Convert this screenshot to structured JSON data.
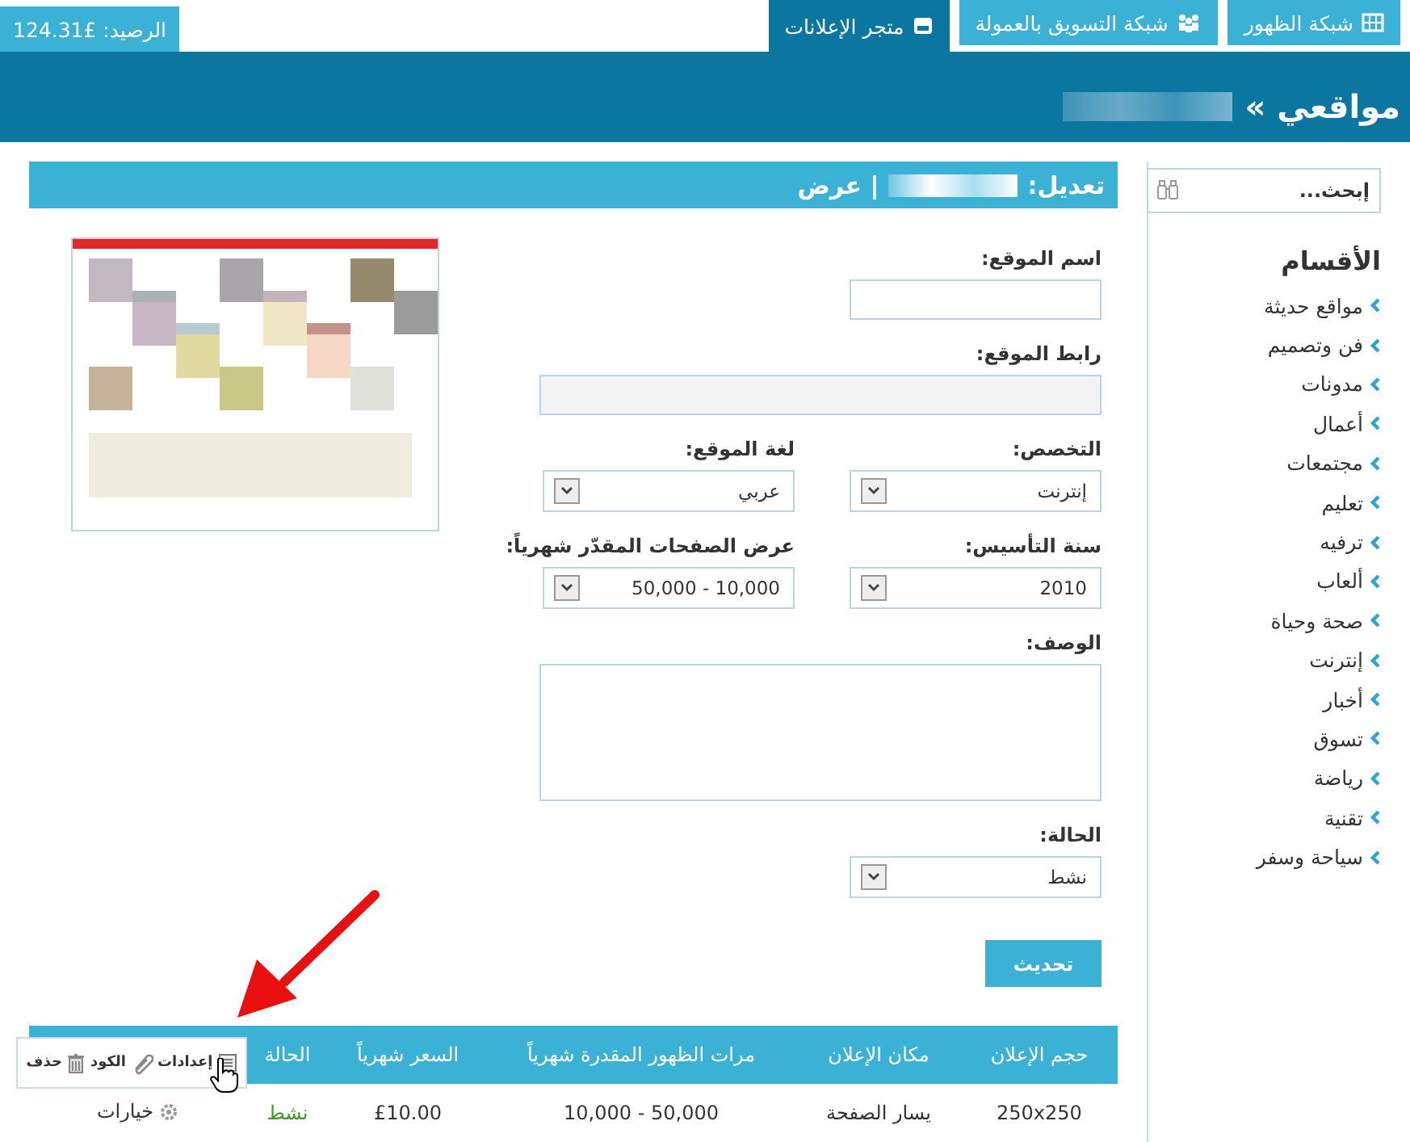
{
  "top_bar": {
    "balance": "الرصيد: £124.31",
    "tabs": [
      {
        "label": "شبكة الظهور",
        "selected": false
      },
      {
        "label": "شبكة التسويق بالعمولة",
        "selected": false
      },
      {
        "label": "متجر الإعلانات",
        "selected": true
      }
    ]
  },
  "header": {
    "title": "مواقعي »"
  },
  "sidebar": {
    "search": {
      "placeholder": "إبحث..."
    },
    "heading": "الأقسام",
    "items": [
      "مواقع حديثة",
      "فن وتصميم",
      "مدونات",
      "أعمال",
      "مجتمعات",
      "تعليم",
      "ترفيه",
      "ألعاب",
      "صحة وحياة",
      "إنترنت",
      "أخبار",
      "تسوق",
      "رياضة",
      "تقنية",
      "سياحة وسفر"
    ]
  },
  "editor": {
    "title_prefix": "تعديل:",
    "title_suffix": "| عرض",
    "fields": [
      {
        "kind": "input",
        "label": "اسم الموقع:",
        "disabled": false
      },
      {
        "kind": "wide_input",
        "label": "رابط الموقع:",
        "disabled": true
      },
      {
        "kind": "select",
        "label": "التخصص:",
        "value": "إنترنت"
      },
      {
        "kind": "select",
        "label": "لغة الموقع:",
        "value": "عربي"
      },
      {
        "kind": "select",
        "label": "سنة التأسيس:",
        "value": "2010"
      },
      {
        "kind": "select",
        "label": "عرض الصفحات المقدّر شهرياً:",
        "value": "50,000 - 10,000"
      },
      {
        "kind": "textarea",
        "label": "الوصف:"
      },
      {
        "kind": "select",
        "label": "الحالة:",
        "value": "نشط"
      }
    ],
    "submit": "تحديث"
  },
  "table": {
    "columns": [
      "حجم الإعلان",
      "مكان الإعلان",
      "مرات الظهور المقدرة شهرياً",
      "السعر شهرياً",
      "الحالة"
    ],
    "rows": [
      {
        "cells": [
          "250x250",
          "يسار الصفحة",
          "10,000 - 50,000",
          "£10.00",
          "نشط"
        ],
        "active": true,
        "options": "خيارات"
      }
    ],
    "menu": [
      {
        "label": "إعدادات"
      },
      {
        "label": "الكود"
      },
      {
        "label": "حذف"
      }
    ]
  }
}
